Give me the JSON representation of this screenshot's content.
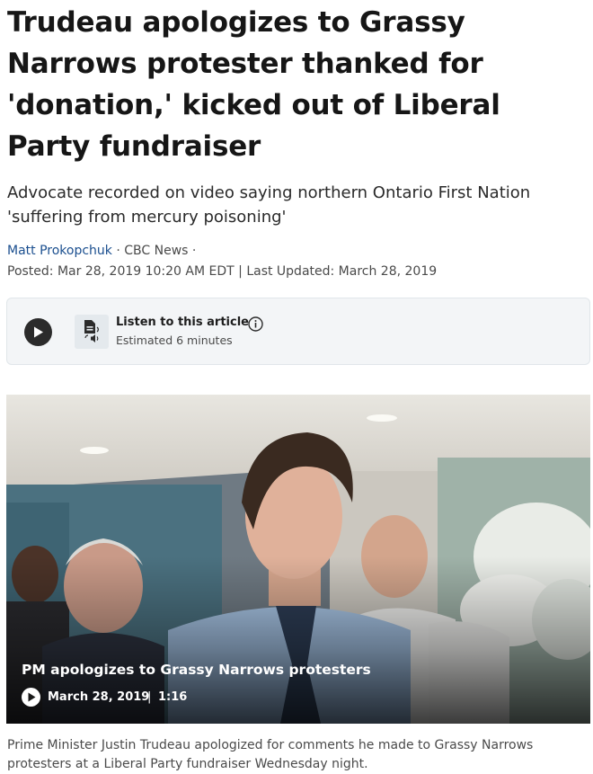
{
  "article": {
    "headline": "Trudeau apologizes to Grassy Narrows protester thanked for 'donation,' kicked out of Liberal Party fundraiser",
    "deck": "Advocate recorded on video saying northern Ontario First Nation 'suffering from mercury poisoning'",
    "author": "Matt Prokopchuk",
    "source": "CBC News",
    "timestamp": "Posted: Mar 28, 2019 10:20 AM EDT | Last Updated: March 28, 2019"
  },
  "audio_player": {
    "title": "Listen to this article",
    "subtitle": "Estimated 6 minutes"
  },
  "video": {
    "title": "PM apologizes to Grassy Narrows protesters",
    "date": "March 28, 2019",
    "separator": "|",
    "duration": "1:16"
  },
  "caption": "Prime Minister Justin Trudeau apologized for comments he made to Grassy Narrows protesters at a Liberal Party fundraiser Wednesday night."
}
